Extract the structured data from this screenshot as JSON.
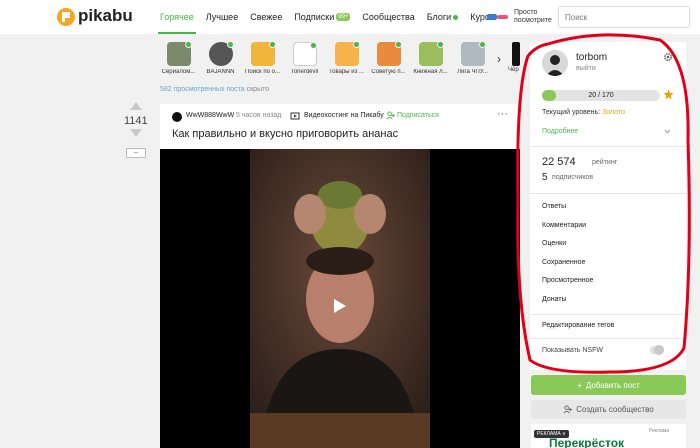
{
  "header": {
    "logo_text": "pikabu",
    "nav": [
      {
        "label": "Горячее",
        "active": true
      },
      {
        "label": "Лучшее"
      },
      {
        "label": "Свежее"
      },
      {
        "label": "Подписки",
        "badge": "99+"
      },
      {
        "label": "Сообщества"
      },
      {
        "label": "Блоги"
      },
      {
        "label": "Курсы"
      }
    ],
    "promo_text": "Просто посмотрите",
    "search_placeholder": "Поиск"
  },
  "stories": [
    {
      "label": "Сериалом..."
    },
    {
      "label": "BAJANNN"
    },
    {
      "label": "Поиск по о..."
    },
    {
      "label": "Tonerdevil"
    },
    {
      "label": "Товары из ..."
    },
    {
      "label": "Советую п..."
    },
    {
      "label": "Книжная л..."
    },
    {
      "label": "Лига ЧПУ..."
    }
  ],
  "stories_edge_label": "Чёр",
  "viewed": {
    "count": "582 просмотренных поста",
    "suffix": "скрыто"
  },
  "post": {
    "votes": "1141",
    "collapse_label": "–",
    "author": "WwW888WwW",
    "time": "5 часов назад",
    "community": "Видеохостинг на Пикабу",
    "subscribe_label": "Подписаться",
    "more_label": "···",
    "title": "Как правильно и вкусно приговорить ананас"
  },
  "profile": {
    "username": "torbom",
    "logout": "выйти",
    "progress_text": "20 / 170",
    "progress_fraction": 0.1176,
    "level_label": "Текущий уровень:",
    "level_value": "Золото",
    "more_link": "Подробнее",
    "rating_value": "22 574",
    "rating_label": "рейтинг",
    "subscribers_value": "5",
    "subscribers_label": "подписчиков",
    "menu": [
      "Ответы",
      "Комментарии",
      "Оценки",
      "Сохраненное",
      "Просмотренное",
      "Донаты"
    ],
    "edit_tags": "Редактирование тегов",
    "nsfw_label": "Показывать NSFW"
  },
  "actions": {
    "add_post": "Добавить пост",
    "create_community": "Создать сообщество"
  },
  "ad": {
    "badge": "РЕКЛАМА ∨",
    "label": "Реклама",
    "brand": "Перекрёсток"
  },
  "colors": {
    "accent": "#4bb34b",
    "progress": "#8ac858",
    "gold": "#e0a800",
    "annotation": "#e0001a"
  }
}
